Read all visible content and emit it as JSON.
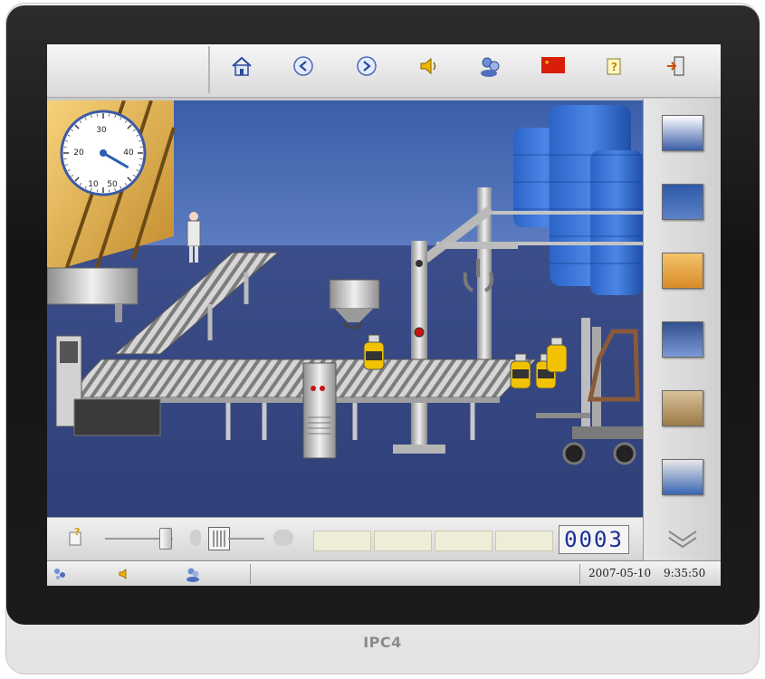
{
  "device": {
    "brand": "IPC4"
  },
  "toolbar": {
    "buttons": [
      {
        "name": "home-button",
        "icon": "home-icon"
      },
      {
        "name": "back-button",
        "icon": "back-arrow-icon"
      },
      {
        "name": "forward-button",
        "icon": "forward-arrow-icon"
      },
      {
        "name": "sound-button",
        "icon": "speaker-icon"
      },
      {
        "name": "users-button",
        "icon": "users-icon"
      },
      {
        "name": "language-button",
        "icon": "china-flag-icon"
      },
      {
        "name": "help-button",
        "icon": "help-note-icon"
      },
      {
        "name": "exit-button",
        "icon": "exit-door-icon"
      }
    ]
  },
  "gauge": {
    "ticks": [
      "10",
      "20",
      "30",
      "40",
      "50"
    ],
    "value": 45,
    "min": 10,
    "max": 50
  },
  "counter": {
    "value": "0003"
  },
  "status": {
    "date": "2007-05-10",
    "time": "9:35:50"
  },
  "colors": {
    "counter_text": "#1c2d9a",
    "scene_blue": "#3f5fa6",
    "counter_bg": "#f4f4f4"
  }
}
